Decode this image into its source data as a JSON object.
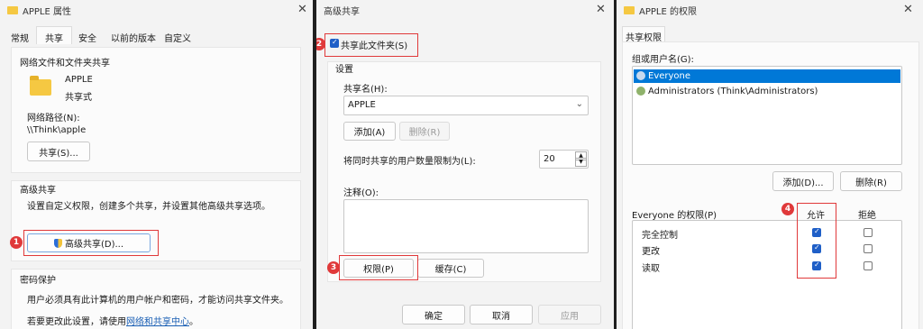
{
  "win1": {
    "title": "APPLE 属性",
    "tabs": [
      "常规",
      "共享",
      "安全",
      "以前的版本",
      "自定义"
    ],
    "section_net_title": "网络文件和文件夹共享",
    "folder_name": "APPLE",
    "folder_state": "共享式",
    "path_label": "网络路径(N):",
    "path_value": "\\\\Think\\apple",
    "share_button": "共享(S)...",
    "adv_title": "高级共享",
    "adv_desc": "设置自定义权限，创建多个共享，并设置其他高级共享选项。",
    "adv_button": "高级共享(D)...",
    "pw_title": "密码保护",
    "pw_desc": "用户必须具有此计算机的用户帐户和密码，才能访问共享文件夹。",
    "pw_change_prefix": "若要更改此设置，请使用",
    "pw_link": "网络和共享中心",
    "pw_change_suffix": "。",
    "badge": "1"
  },
  "win2": {
    "title": "高级共享",
    "share_checkbox": "共享此文件夹(S)",
    "share_checked": true,
    "settings_label": "设置",
    "share_name_label": "共享名(H):",
    "share_name_value": "APPLE",
    "add_button": "添加(A)",
    "delete_button": "删除(R)",
    "limit_label": "将同时共享的用户数量限制为(L):",
    "limit_value": "20",
    "comment_label": "注释(O):",
    "perm_button": "权限(P)",
    "cache_button": "缓存(C)",
    "ok_button": "确定",
    "cancel_button": "取消",
    "apply_button": "应用",
    "badge_share": "2",
    "badge_perm": "3"
  },
  "win3": {
    "title": "APPLE 的权限",
    "tab": "共享权限",
    "group_label": "组或用户名(G):",
    "users": [
      "Everyone",
      "Administrators (Think\\Administrators)"
    ],
    "add_button": "添加(D)...",
    "delete_button": "删除(R)",
    "perm_label": "Everyone 的权限(P)",
    "allow_header": "允许",
    "deny_header": "拒绝",
    "permissions": [
      {
        "name": "完全控制",
        "allow": true,
        "deny": false
      },
      {
        "name": "更改",
        "allow": true,
        "deny": false
      },
      {
        "name": "读取",
        "allow": true,
        "deny": false
      }
    ],
    "badge": "4"
  },
  "colors": {
    "annotation_red": "#e0393a",
    "selection_blue": "#0078d7",
    "checkbox_blue": "#1f5fc7",
    "link_blue": "#1a5fb4",
    "folder_yellow": "#f5c842"
  }
}
